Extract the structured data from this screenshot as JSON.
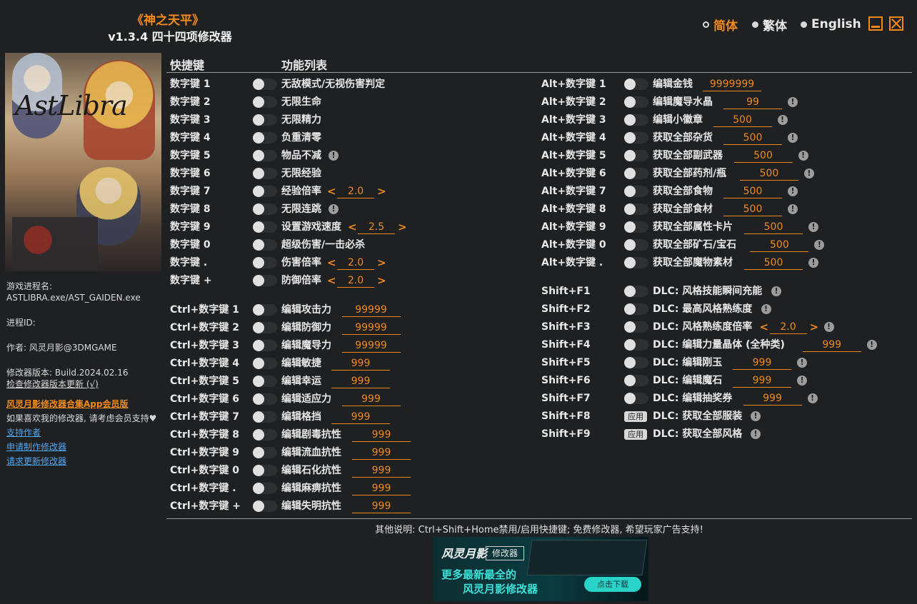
{
  "header": {
    "title": "《神之天平》",
    "subtitle": "v1.3.4 四十四项修改器"
  },
  "languages": [
    {
      "label": "简体",
      "selected": true
    },
    {
      "label": "繁体",
      "selected": false
    },
    {
      "label": "English",
      "selected": false
    }
  ],
  "colors": {
    "accent": "#f08a1c",
    "link": "#4fa6f0",
    "background": "#1f2022"
  },
  "sidebar": {
    "process_label": "游戏进程名:",
    "process_value": "ASTLIBRA.exe/AST_GAIDEN.exe",
    "pid_label": "进程ID:",
    "author": "作者: 风灵月影@3DMGAME",
    "version": "修改器版本: Build.2024.02.16",
    "check_update": "检查修改器版本更新 (√)",
    "app_link": "风灵月影修改器合集App会员版",
    "support_text": "如果喜欢我的修改器, 请考虑会员支持♥",
    "links": [
      "支持作者",
      "申请制作修改器",
      "请求更新修改器"
    ]
  },
  "columns": {
    "hotkey": "快捷键",
    "features": "功能列表"
  },
  "left": [
    {
      "key": "数字键 1",
      "label": "无敌模式/无视伤害判定"
    },
    {
      "key": "数字键 2",
      "label": "无限生命"
    },
    {
      "key": "数字键 3",
      "label": "无限精力"
    },
    {
      "key": "数字键 4",
      "label": "负重清零"
    },
    {
      "key": "数字键 5",
      "label": "物品不减",
      "info": "!"
    },
    {
      "key": "数字键 6",
      "label": "无限经验"
    },
    {
      "key": "数字键 7",
      "label": "经验倍率",
      "stepper": "2.0"
    },
    {
      "key": "数字键 8",
      "label": "无限连跳",
      "info": "!"
    },
    {
      "key": "数字键 9",
      "label": "设置游戏速度",
      "stepper": "2.5"
    },
    {
      "key": "数字键 0",
      "label": "超级伤害/一击必杀"
    },
    {
      "key": "数字键 .",
      "label": "伤害倍率",
      "stepper": "2.0"
    },
    {
      "key": "数字键 +",
      "label": "防御倍率",
      "stepper": "2.0"
    },
    {
      "key": "Ctrl+数字键 1",
      "label": "编辑攻击力",
      "value": "99999"
    },
    {
      "key": "Ctrl+数字键 2",
      "label": "编辑防御力",
      "value": "99999"
    },
    {
      "key": "Ctrl+数字键 3",
      "label": "编辑魔导力",
      "value": "99999"
    },
    {
      "key": "Ctrl+数字键 4",
      "label": "编辑敏捷",
      "value": "999"
    },
    {
      "key": "Ctrl+数字键 5",
      "label": "编辑幸运",
      "value": "999"
    },
    {
      "key": "Ctrl+数字键 6",
      "label": "编辑适应力",
      "value": "999"
    },
    {
      "key": "Ctrl+数字键 7",
      "label": "编辑格挡",
      "value": "999"
    },
    {
      "key": "Ctrl+数字键 8",
      "label": "编辑剧毒抗性",
      "value": "999"
    },
    {
      "key": "Ctrl+数字键 9",
      "label": "编辑流血抗性",
      "value": "999"
    },
    {
      "key": "Ctrl+数字键 0",
      "label": "编辑石化抗性",
      "value": "999"
    },
    {
      "key": "Ctrl+数字键 .",
      "label": "编辑麻痹抗性",
      "value": "999"
    },
    {
      "key": "Ctrl+数字键 +",
      "label": "编辑失明抗性",
      "value": "999"
    }
  ],
  "right": [
    {
      "key": "Alt+数字键 1",
      "label": "编辑金钱",
      "value": "9999999"
    },
    {
      "key": "Alt+数字键 2",
      "label": "编辑魔导水晶",
      "value": "99",
      "info": "!"
    },
    {
      "key": "Alt+数字键 3",
      "label": "编辑小徽章",
      "value": "500",
      "info": "!"
    },
    {
      "key": "Alt+数字键 4",
      "label": "获取全部杂货",
      "value": "500",
      "info": "!"
    },
    {
      "key": "Alt+数字键 5",
      "label": "获取全部副武器",
      "value": "500",
      "info": "!"
    },
    {
      "key": "Alt+数字键 6",
      "label": "获取全部药剂/瓶",
      "value": "500",
      "info": "!"
    },
    {
      "key": "Alt+数字键 7",
      "label": "获取全部食物",
      "value": "500",
      "info": "!"
    },
    {
      "key": "Alt+数字键 8",
      "label": "获取全部食材",
      "value": "500",
      "info": "!"
    },
    {
      "key": "Alt+数字键 9",
      "label": "获取全部属性卡片",
      "value": "500",
      "info": "!"
    },
    {
      "key": "Alt+数字键 0",
      "label": "获取全部矿石/宝石",
      "value": "500",
      "info": "!"
    },
    {
      "key": "Alt+数字键 .",
      "label": "获取全部魔物素材",
      "value": "500",
      "info": "!"
    },
    {
      "key": "Shift+F1",
      "label": "DLC: 风格技能瞬间充能",
      "info": "!"
    },
    {
      "key": "Shift+F2",
      "label": "DLC: 最高风格熟练度",
      "info": "!"
    },
    {
      "key": "Shift+F3",
      "label": "DLC: 风格熟练度倍率",
      "stepper": "2.0",
      "info": "!"
    },
    {
      "key": "Shift+F4",
      "label": "DLC: 编辑力量晶体 (全种类)",
      "value": "999",
      "info": "!"
    },
    {
      "key": "Shift+F5",
      "label": "DLC: 编辑刚玉",
      "value": "999",
      "info": "!"
    },
    {
      "key": "Shift+F6",
      "label": "DLC: 编辑魔石",
      "value": "999",
      "info": "!"
    },
    {
      "key": "Shift+F7",
      "label": "DLC: 编辑抽奖券",
      "value": "999",
      "info": "!"
    },
    {
      "key": "Shift+F8",
      "label": "DLC: 获取全部服装",
      "apply": "应用",
      "info": "!"
    },
    {
      "key": "Shift+F9",
      "label": "DLC: 获取全部风格",
      "apply": "应用",
      "info": "!"
    }
  ],
  "footer": {
    "note": "其他说明: Ctrl+Shift+Home禁用/启用快捷键; 免费修改器, 希望玩家广告支持!"
  },
  "banner": {
    "logo": "风灵月影",
    "tag": "修改器",
    "line1": "更多最新最全的",
    "line2": "风灵月影修改器",
    "button": "点击下载"
  }
}
